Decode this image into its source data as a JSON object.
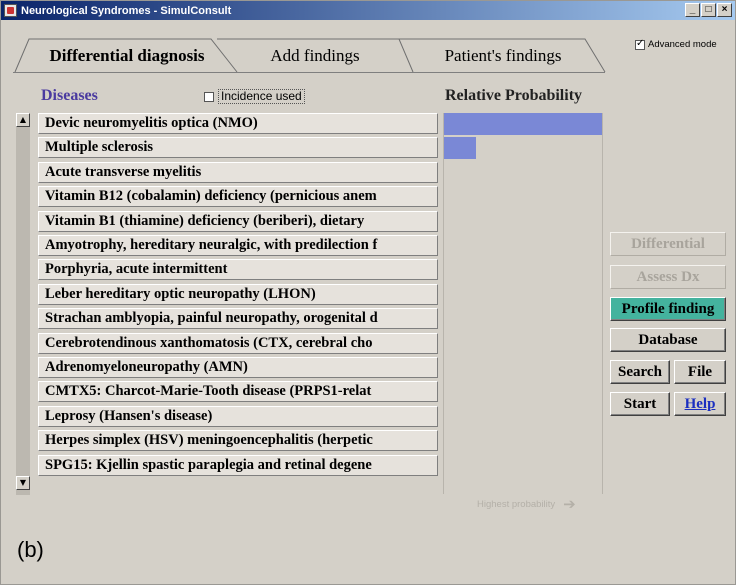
{
  "window": {
    "title": "Neurological Syndromes - SimulConsult",
    "controls": {
      "minimize": "_",
      "maximize": "□",
      "close": "×"
    }
  },
  "tabs": [
    {
      "label": "Differential diagnosis",
      "active": true
    },
    {
      "label": "Add findings",
      "active": false
    },
    {
      "label": "Patient's findings",
      "active": false
    }
  ],
  "advanced_mode": {
    "label": "Advanced mode",
    "checked": true
  },
  "diseases_header": {
    "title": "Diseases",
    "incidence_label": "Incidence used",
    "incidence_checked": false
  },
  "relative_probability_title": "Relative Probability",
  "diseases": [
    {
      "name": "Devic neuromyelitis optica (NMO)",
      "probability": 1.0
    },
    {
      "name": "Multiple sclerosis",
      "probability": 0.2
    },
    {
      "name": "Acute transverse myelitis",
      "probability": 0
    },
    {
      "name": "Vitamin B12 (cobalamin) deficiency (pernicious anem",
      "probability": 0
    },
    {
      "name": "Vitamin B1 (thiamine) deficiency (beriberi), dietary",
      "probability": 0
    },
    {
      "name": "Amyotrophy, hereditary neuralgic, with predilection f",
      "probability": 0
    },
    {
      "name": "Porphyria, acute intermittent",
      "probability": 0
    },
    {
      "name": "Leber hereditary optic neuropathy (LHON)",
      "probability": 0
    },
    {
      "name": "Strachan amblyopia, painful neuropathy, orogenital d",
      "probability": 0
    },
    {
      "name": "Cerebrotendinous xanthomatosis (CTX, cerebral cho",
      "probability": 0
    },
    {
      "name": "Adrenomyeloneuropathy (AMN)",
      "probability": 0
    },
    {
      "name": "CMTX5: Charcot-Marie-Tooth disease (PRPS1-relat",
      "probability": 0
    },
    {
      "name": "Leprosy (Hansen's disease)",
      "probability": 0
    },
    {
      "name": "Herpes simplex (HSV) meningoencephalitis (herpetic",
      "probability": 0
    },
    {
      "name": "SPG15: Kjellin spastic paraplegia and retinal degene",
      "probability": 0
    }
  ],
  "highest_probability_label": "Highest probability",
  "buttons": {
    "differential": "Differential",
    "assess_dx": "Assess Dx",
    "profile_finding": "Profile finding",
    "database": "Database",
    "search": "Search",
    "file": "File",
    "start": "Start",
    "help": "Help"
  },
  "colors": {
    "probability_bar": "#7a88d6",
    "profile_finding_bg": "#44b39e",
    "diseases_title": "#4a3aa0"
  },
  "caption": "(b)"
}
